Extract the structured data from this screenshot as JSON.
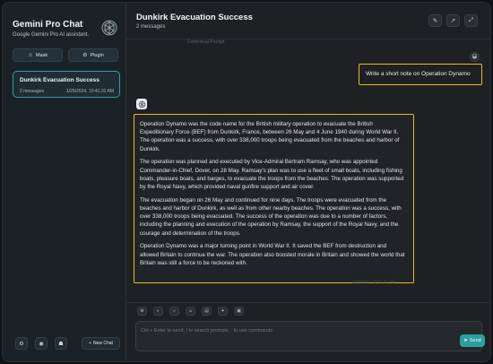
{
  "sidebar": {
    "title": "Gemini Pro Chat",
    "subtitle": "Google Gemini Pro AI assistant.",
    "mask_label": "Mask",
    "plugin_label": "Plugin",
    "chats": [
      {
        "title": "Dunkirk Evacuation Success",
        "count": "2 messages",
        "date": "1/25/2024, 10:41:31 AM"
      }
    ],
    "new_chat_label": "New Chat"
  },
  "header": {
    "title": "Dunkirk Evacuation Success",
    "subtitle": "2 messages"
  },
  "context_prompt": "Contextual Prompt",
  "messages": {
    "user": "Write a short note on Operation Dynamo",
    "bot": [
      "Operation Dynamo was the code name for the British military operation to evacuate the British Expeditionary Force (BEF) from Dunkirk, France, between 26 May and 4 June 1940 during World War II. The operation was a success, with over 338,000 troops being evacuated from the beaches and harbor of Dunkirk.",
      "The operation was planned and executed by Vice-Admiral Bertram Ramsay, who was appointed Commander-in-Chief, Dover, on 28 May. Ramsay's plan was to use a fleet of small boats, including fishing boats, pleasure boats, and barges, to evacuate the troops from the beaches. The operation was supported by the Royal Navy, which provided naval gunfire support and air cover.",
      "The evacuation began on 26 May and continued for nine days. The troops were evacuated from the beaches and harbor of Dunkirk, as well as from other nearby beaches. The operation was a success, with over 338,000 troops being evacuated. The success of the operation was due to a number of factors, including the planning and execution of the operation by Ramsay, the support of the Royal Navy, and the courage and determination of the troops.",
      "Operation Dynamo was a major turning point in World War II. It saved the BEF from destruction and allowed Britain to continue the war. The operation also boosted morale in Britain and showed the world that Britain was still a force to be reckoned with."
    ],
    "bot_date": "1/25/2024, 10:41:31 AM"
  },
  "input": {
    "placeholder": "Ctrl + Enter to send, / to search prompts, : to use commands",
    "send_label": "Send"
  },
  "colors": {
    "accent": "#2aa1a0",
    "highlight": "#e0c21a"
  }
}
